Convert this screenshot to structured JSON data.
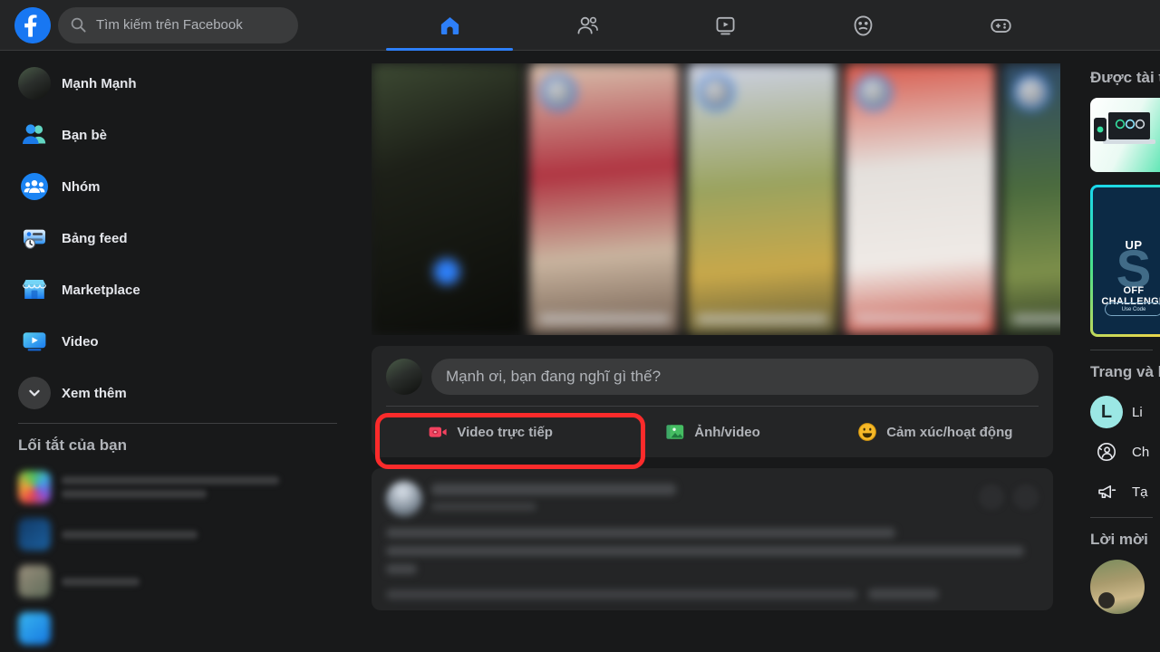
{
  "topbar": {
    "logo_icon": "facebook-logo-icon",
    "search": {
      "icon": "search-icon",
      "placeholder": "Tìm kiếm trên Facebook",
      "value": ""
    },
    "nav_tabs": [
      {
        "name": "home",
        "icon": "home-icon",
        "active": true,
        "label": "Trang chủ"
      },
      {
        "name": "friends",
        "icon": "friends-icon",
        "active": false,
        "label": "Bạn bè"
      },
      {
        "name": "video",
        "icon": "video-icon",
        "active": false,
        "label": "Video"
      },
      {
        "name": "groups",
        "icon": "groups-icon",
        "active": false,
        "label": "Nhóm"
      },
      {
        "name": "gaming",
        "icon": "gaming-icon",
        "active": false,
        "label": "Chơi game"
      }
    ]
  },
  "sidebar": {
    "items": [
      {
        "label": "Mạnh Mạnh",
        "icon": "user-avatar"
      },
      {
        "label": "Bạn bè",
        "icon": "friends-icon"
      },
      {
        "label": "Nhóm",
        "icon": "groups-icon"
      },
      {
        "label": "Bảng feed",
        "icon": "news-feed-icon"
      },
      {
        "label": "Marketplace",
        "icon": "marketplace-icon"
      },
      {
        "label": "Video",
        "icon": "video-icon"
      },
      {
        "label": "Xem thêm",
        "icon": "chevron-down-icon"
      }
    ],
    "shortcuts_heading": "Lối tắt của bạn",
    "shortcuts": [
      {
        "blurred": true,
        "lines": 2
      },
      {
        "blurred": true,
        "lines": 1
      },
      {
        "blurred": true,
        "lines": 1
      },
      {
        "blurred": true,
        "lines": 1
      }
    ]
  },
  "feed": {
    "stories_count": 5,
    "composer": {
      "avatar": "user-avatar",
      "placeholder": "Mạnh ơi, bạn đang nghĩ gì thế?",
      "actions": [
        {
          "label": "Video trực tiếp",
          "icon": "live-video-icon",
          "color": "#f3425f",
          "highlighted": true
        },
        {
          "label": "Ảnh/video",
          "icon": "photo-video-icon",
          "color": "#45bd62",
          "highlighted": false
        },
        {
          "label": "Cảm xúc/hoạt động",
          "icon": "emoji-icon",
          "color": "#f7b928",
          "highlighted": false
        }
      ]
    },
    "post": {
      "blurred": true,
      "more_options_icon": "more-options-icon",
      "close_icon": "close-icon"
    }
  },
  "right_rail": {
    "sponsored_heading": "Được tài trợ",
    "ads": [
      {
        "name": "ad-devices",
        "blurred": false
      },
      {
        "name": "ad-challenge",
        "headline": "UP",
        "subline": "OFF CHALLENGE",
        "cta": "Use Code",
        "big": "S"
      }
    ],
    "pages_heading": "Trang và hồ sơ",
    "pages_items": [
      {
        "label": "Li",
        "icon": "page-avatar-L",
        "avatar_letter": "L"
      },
      {
        "label": "Ch",
        "icon": "switch-profile-icon"
      },
      {
        "label": "Tạ",
        "icon": "megaphone-icon"
      }
    ],
    "invites_heading": "Lời mời",
    "invites": [
      {
        "icon": "friend-avatar"
      }
    ]
  },
  "annotation": {
    "type": "highlight-rectangle",
    "color": "#fb2b2b",
    "target": "Video trực tiếp"
  }
}
